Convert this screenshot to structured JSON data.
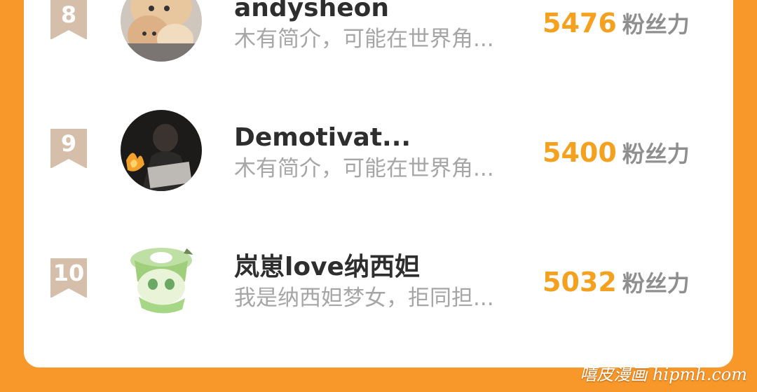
{
  "leaderboard": {
    "rows": [
      {
        "rank": "8",
        "name": "andysheon",
        "bio": "木有简介，可能在世界角...",
        "score": "5476",
        "unit": "粉丝力"
      },
      {
        "rank": "9",
        "name": "Demotivat...",
        "bio": "木有简介，可能在世界角...",
        "score": "5400",
        "unit": "粉丝力"
      },
      {
        "rank": "10",
        "name": "岚崽love纳西妲",
        "bio": "我是纳西妲梦女，拒同担...",
        "score": "5032",
        "unit": "粉丝力"
      }
    ]
  },
  "watermark": "嘻皮漫画 hipmh.com",
  "colors": {
    "background": "#f9982a",
    "card": "#ffffff",
    "score": "#f3a11f",
    "badge": "#d5bfab",
    "bio": "#a6a6a6",
    "name": "#2e2e2e"
  }
}
